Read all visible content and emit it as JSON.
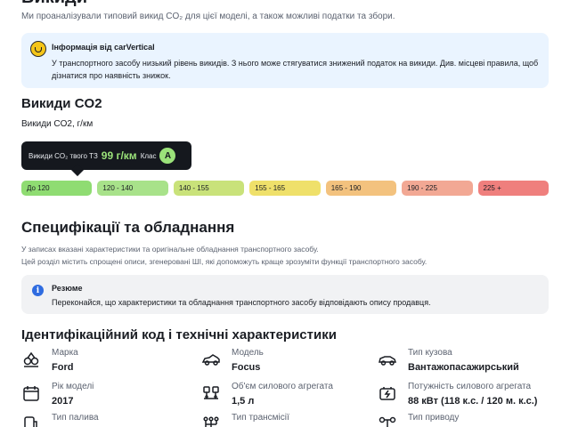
{
  "header": {
    "title": "Викиди",
    "intro": "Ми проаналізували типовий викид CO₂ для цієї моделі, а також можливі податки та збори."
  },
  "info": {
    "title": "Інформація від carVertical",
    "body": "У транспортного засобу низький рівень викидів. З нього може стягуватися знижений податок на викиди. Див. місцеві правила, щоб дізнатися про наявність знижок."
  },
  "co2": {
    "heading": "Викиди CO2",
    "subheading": "Викиди CO2, г/км",
    "tooltip": {
      "label": "Викиди CO₂ твого ТЗ",
      "value": "99 г/км",
      "class_label": "Клас",
      "class_value": "A"
    },
    "scale": [
      {
        "label": "До 120",
        "color": "#8fdc72"
      },
      {
        "label": "120 - 140",
        "color": "#a8e28a"
      },
      {
        "label": "140 - 155",
        "color": "#c9e27a"
      },
      {
        "label": "155 - 165",
        "color": "#efe06a"
      },
      {
        "label": "165 - 190",
        "color": "#f3c27e"
      },
      {
        "label": "190 - 225",
        "color": "#f2a894"
      },
      {
        "label": "225 +",
        "color": "#ef7f7d"
      }
    ]
  },
  "specs_section": {
    "heading": "Специфікації та обладнання",
    "note_line1": "У записах вказані характеристики та оригінальне обладнання транспортного засобу.",
    "note_line2": "Цей розділ містить спрощені описи, згенеровані ШІ, які допоможуть краще зрозуміти функції транспортного засобу."
  },
  "resume": {
    "title": "Резюме",
    "body": "Переконайся, що характеристики та обладнання транспортного засобу відповідають опису продавця."
  },
  "identification": {
    "heading": "Ідентифікаційний код і технічні характеристики",
    "items": [
      {
        "key": "Марка",
        "value": "Ford",
        "icon": "brand-icon"
      },
      {
        "key": "Модель",
        "value": "Focus",
        "icon": "car-icon"
      },
      {
        "key": "Тип кузова",
        "value": "Вантажопасажирський",
        "icon": "car-body-icon"
      },
      {
        "key": "Рік моделі",
        "value": "2017",
        "icon": "calendar-icon"
      },
      {
        "key": "Об'єм силового агрегата",
        "value": "1,5 л",
        "icon": "engine-volume-icon"
      },
      {
        "key": "Потужність силового агрегата",
        "value": "88 кВт (118 к.с. / 120 м. к.с.)",
        "icon": "battery-power-icon"
      },
      {
        "key": "Тип палива",
        "value": "",
        "icon": "fuel-icon"
      },
      {
        "key": "Тип трансмісії",
        "value": "",
        "icon": "transmission-icon"
      },
      {
        "key": "Тип приводу",
        "value": "",
        "icon": "drive-icon"
      }
    ]
  }
}
